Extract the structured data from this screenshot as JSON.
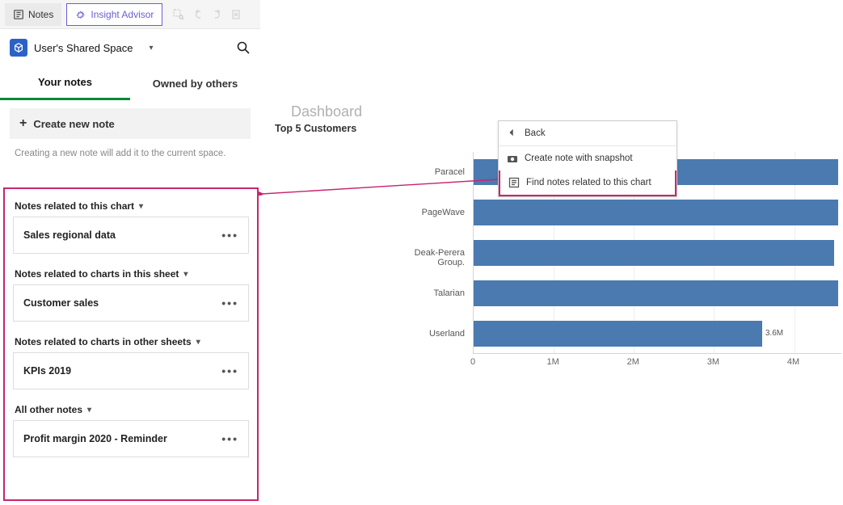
{
  "toolbar": {
    "notes_label": "Notes",
    "insight_label": "Insight Advisor"
  },
  "space": {
    "name": "User's Shared Space"
  },
  "tabs": {
    "your_notes": "Your notes",
    "owned_by_others": "Owned by others"
  },
  "create": {
    "label": "Create new note",
    "hint": "Creating a new note will add it to the current space."
  },
  "sections": [
    {
      "title": "Notes related to this chart",
      "note": "Sales regional data"
    },
    {
      "title": "Notes related to charts in this sheet",
      "note": "Customer sales"
    },
    {
      "title": "Notes related to charts in other sheets",
      "note": "KPIs 2019"
    },
    {
      "title": "All other notes",
      "note": "Profit margin 2020 - Reminder"
    }
  ],
  "main": {
    "title": "Dashboard",
    "chart_title": "Top 5 Customers"
  },
  "context_menu": {
    "back": "Back",
    "create_snapshot": "Create note with snapshot",
    "find_related": "Find notes related to this chart"
  },
  "chart_data": {
    "type": "bar",
    "orientation": "horizontal",
    "title": "Top 5 Customers",
    "xlabel": "",
    "ylabel": "",
    "xlim": [
      0,
      4600000
    ],
    "ticks": [
      "0",
      "1M",
      "2M",
      "3M",
      "4M"
    ],
    "categories": [
      "Paracel",
      "PageWave",
      "Deak-Perera Group.",
      "Talarian",
      "Userland"
    ],
    "values": [
      4550000,
      4550000,
      4500000,
      4550000,
      3600000
    ],
    "value_labels": [
      "",
      "",
      "",
      "",
      "3.6M"
    ],
    "bar_color": "#4a7ab0"
  }
}
